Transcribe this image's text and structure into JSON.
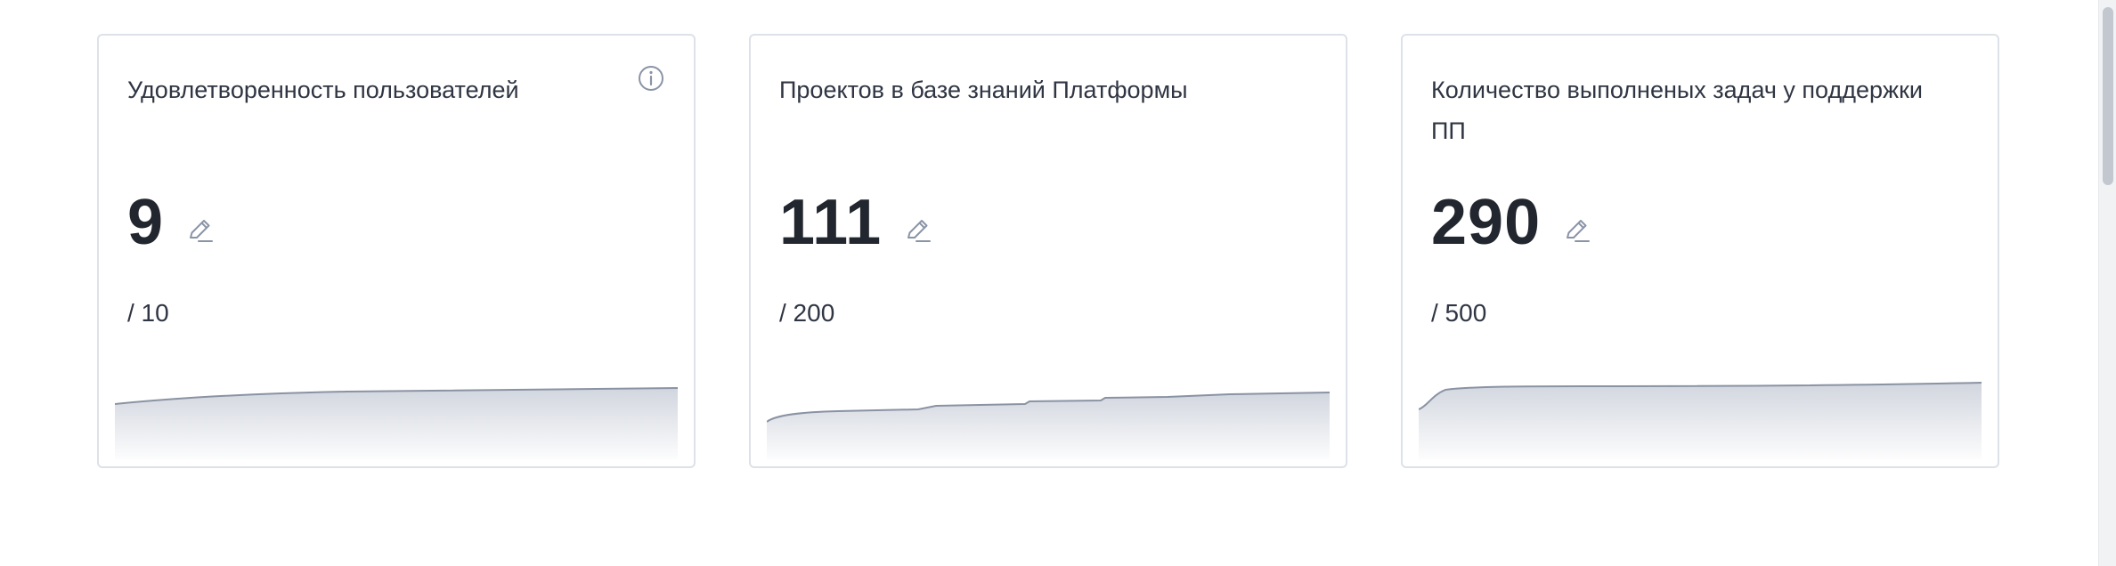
{
  "colors": {
    "card_border": "#dde2e8",
    "icon": "#8a94a6",
    "sparkline_stroke": "#8a93a3",
    "sparkline_fill": "#c9ced8"
  },
  "cards": [
    {
      "title": "Удовлетворенность пользователей",
      "value": "9",
      "target": "/ 10",
      "has_info_icon": true,
      "progress": 0.9
    },
    {
      "title": "Проектов в базе знаний Платформы",
      "value": "111",
      "target": "/ 200",
      "has_info_icon": false,
      "progress": 0.555
    },
    {
      "title": "Количество выполненых задач у поддержки ПП",
      "value": "290",
      "target": "/ 500",
      "has_info_icon": false,
      "progress": 0.58
    }
  ],
  "icons": {
    "info": "info-icon",
    "edit": "pencil-icon"
  }
}
